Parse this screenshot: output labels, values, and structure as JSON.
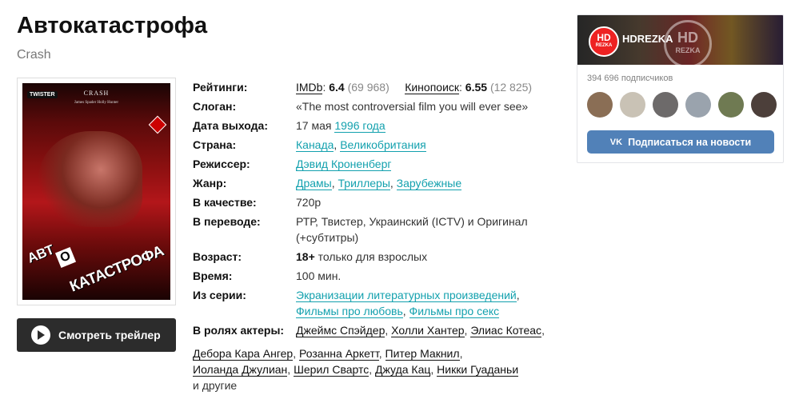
{
  "movie": {
    "title": "Автокатастрофа",
    "original_title": "Crash"
  },
  "poster": {
    "studio_logo": "TWISTER",
    "title_text": "CRASH",
    "names_text": "James Spader     Holly Hunter",
    "dvd_badge": "DVD",
    "big_title_part1": "АВТ",
    "big_title_o": "О",
    "big_title_part2": "КАТАСТРОФА"
  },
  "trailer_button": {
    "label": "Смотреть трейлер"
  },
  "info": {
    "ratings": {
      "label": "Рейтинги:",
      "imdb_name": "IMDb",
      "imdb_value": "6.4",
      "imdb_votes": "(69 968)",
      "kp_name": "Кинопоиск",
      "kp_value": "6.55",
      "kp_votes": "(12 825)"
    },
    "slogan": {
      "label": "Слоган:",
      "value": "«The most controversial film you will ever see»"
    },
    "release": {
      "label": "Дата выхода:",
      "date": "17 мая",
      "year": "1996 года"
    },
    "country": {
      "label": "Страна:",
      "values": [
        "Канада",
        "Великобритания"
      ]
    },
    "director": {
      "label": "Режиссер:",
      "value": "Дэвид Кроненберг"
    },
    "genre": {
      "label": "Жанр:",
      "values": [
        "Драмы",
        "Триллеры",
        "Зарубежные"
      ]
    },
    "quality": {
      "label": "В качестве:",
      "value": "720p"
    },
    "translation": {
      "label": "В переводе:",
      "line1": "РТР, Твистер, Украинский (ICTV) и Оригинал",
      "line2": "(+субтитры)"
    },
    "age": {
      "label": "Возраст:",
      "rating": "18+",
      "text": "только для взрослых"
    },
    "duration": {
      "label": "Время:",
      "value": "100 мин."
    },
    "series": {
      "label": "Из серии:",
      "values": [
        "Экранизации литературных произведений",
        "Фильмы про любовь",
        "Фильмы про секс"
      ]
    },
    "cast": {
      "label": "В ролях актеры:",
      "actors": [
        "Джеймс Спэйдер",
        "Холли Хантер",
        "Элиас Котеас",
        "Дебора Кара Ангер",
        "Розанна Аркетт",
        "Питер Макнил",
        "Иоланда Джулиан",
        "Шерил Свартс",
        "Джуда Кац",
        "Никки Гуаданьи"
      ],
      "more": "и другие"
    }
  },
  "vk": {
    "badge_hd": "HD",
    "badge_rezka": "REZKA",
    "group_name": "HDREZKA",
    "subscribers": "394 696 подписчиков",
    "subscribe_logo": "VK",
    "subscribe_label": "Подписаться на новости",
    "avatar_colors": [
      "#8a6e55",
      "#c9c2b5",
      "#6d6a6a",
      "#9aa3ad",
      "#6f7a52",
      "#4c3f3a"
    ]
  }
}
